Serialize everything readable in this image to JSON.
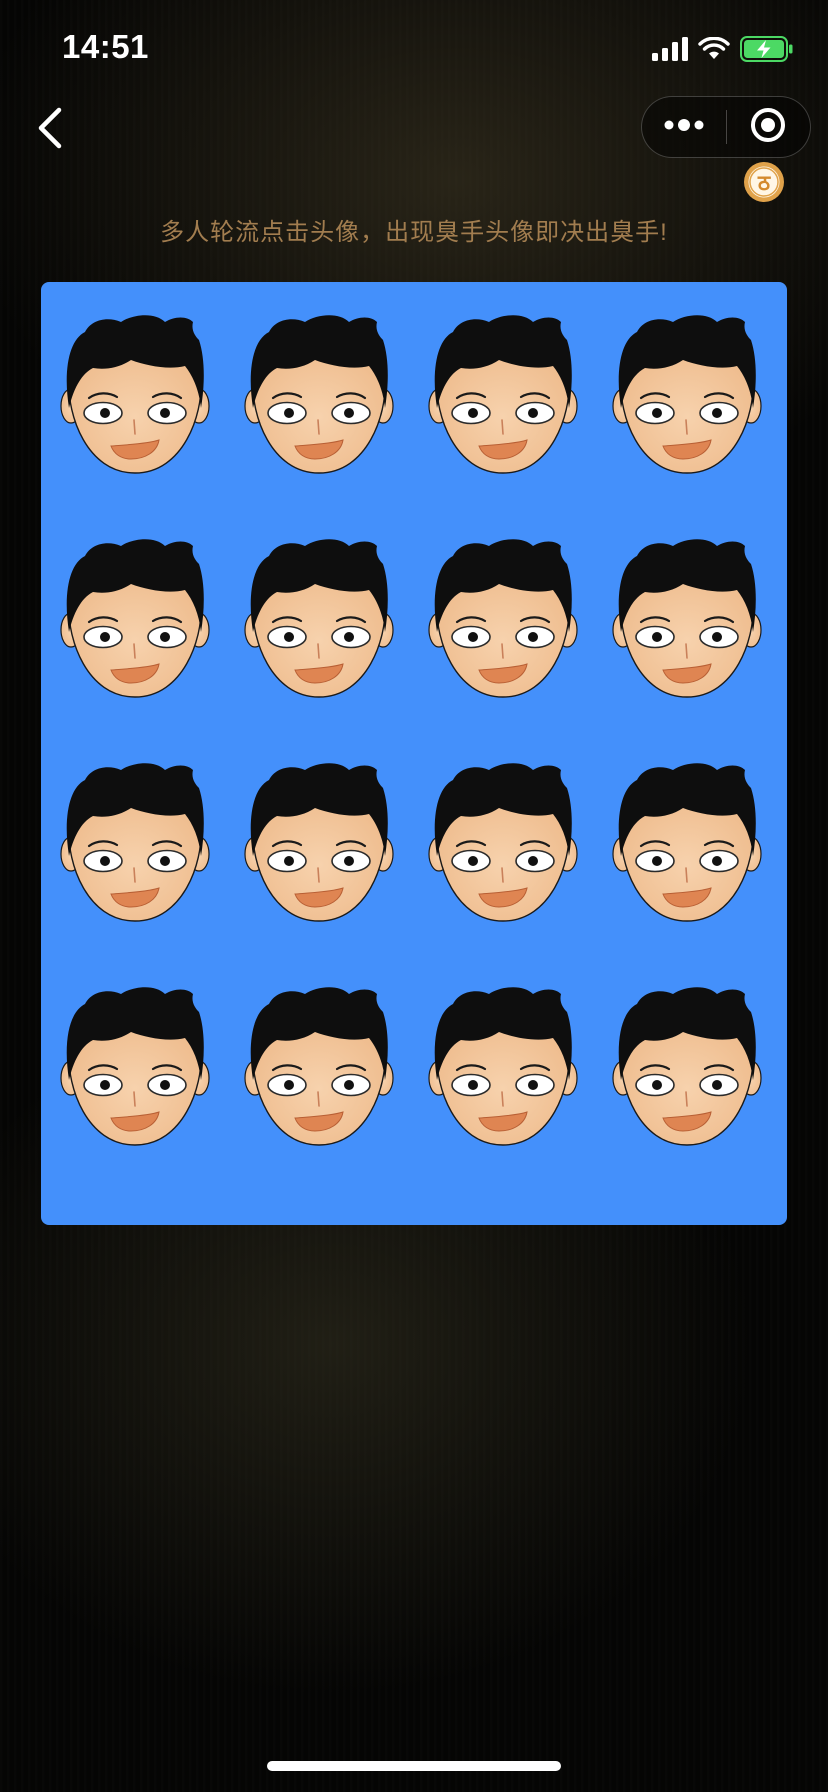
{
  "status_bar": {
    "time": "14:51",
    "icons": [
      "signal-icon",
      "wifi-icon",
      "battery-charging-icon"
    ],
    "battery_color": "#4cd964"
  },
  "nav": {
    "back_icon": "chevron-left-icon",
    "menu_icon": "more-dots-icon",
    "close_icon": "target-close-icon",
    "badge_icon": "gold-badge-icon",
    "badge_glyph": "ठ"
  },
  "instruction": {
    "text": "多人轮流点击头像，出现臭手头像即决出臭手!"
  },
  "board": {
    "background_color": "#4490fb",
    "rows": 4,
    "columns": 4,
    "avatar_icon": "boy-face-avatar-icon",
    "avatars": [
      {
        "id": 1
      },
      {
        "id": 2
      },
      {
        "id": 3
      },
      {
        "id": 4
      },
      {
        "id": 5
      },
      {
        "id": 6
      },
      {
        "id": 7
      },
      {
        "id": 8
      },
      {
        "id": 9
      },
      {
        "id": 10
      },
      {
        "id": 11
      },
      {
        "id": 12
      },
      {
        "id": 13
      },
      {
        "id": 14
      },
      {
        "id": 15
      },
      {
        "id": 16
      }
    ]
  },
  "colors": {
    "instruction_text": "#a27d4f",
    "badge_gold": "#e0a24a",
    "skin": "#f4c9a0",
    "hair": "#0e0e0e",
    "mouth": "#df8552"
  }
}
